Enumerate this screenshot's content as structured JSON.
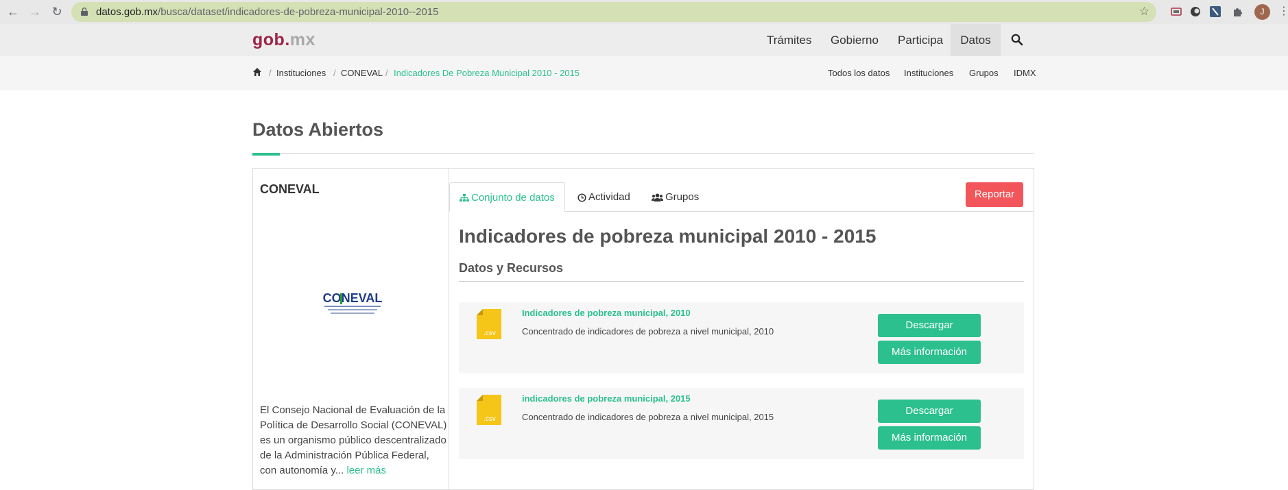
{
  "browser": {
    "url_host": "datos.gob.mx",
    "url_path": "/busca/dataset/indicadores-de-pobreza-municipal-2010--2015",
    "profile_initial": "J"
  },
  "header": {
    "logo_gob": "gob",
    "logo_dot": ".",
    "logo_mx": "mx",
    "nav": [
      "Trámites",
      "Gobierno",
      "Participa",
      "Datos"
    ]
  },
  "breadcrumb": {
    "items": [
      "Instituciones",
      "CONEVAL",
      "Indicadores De Pobreza Municipal 2010 - 2015"
    ],
    "separator": "/",
    "right_links": [
      "Todos los datos",
      "Instituciones",
      "Grupos",
      "IDMX"
    ]
  },
  "page": {
    "title": "Datos Abiertos"
  },
  "organization": {
    "name": "CONEVAL",
    "logo_text": "CONEVAL",
    "description": "El Consejo Nacional de Evaluación de la Política de Desarrollo Social (CONEVAL) es un organismo público descentralizado de la Administración Pública Federal, con autonomía y...",
    "read_more": "leer más"
  },
  "tabs": [
    "Conjunto de datos",
    "Actividad",
    "Grupos"
  ],
  "report_label": "Reportar",
  "dataset": {
    "title": "Indicadores de pobreza municipal 2010 - 2015",
    "resources_heading": "Datos y Recursos",
    "resources": [
      {
        "name": "Indicadores de pobreza municipal, 2010",
        "description": "Concentrado de indicadores de pobreza a nivel municipal, 2010",
        "format": ".csv",
        "download_label": "Descargar",
        "info_label": "Más información"
      },
      {
        "name": "indicadores de pobreza municipal, 2015",
        "description": "Concentrado de indicadores de pobreza a nivel municipal, 2015",
        "format": ".csv",
        "download_label": "Descargar",
        "info_label": "Más información"
      }
    ]
  },
  "colors": {
    "accent": "#2bc08e",
    "brand": "#9d2449",
    "report": "#f2555a",
    "csv_icon": "#f5c518"
  }
}
